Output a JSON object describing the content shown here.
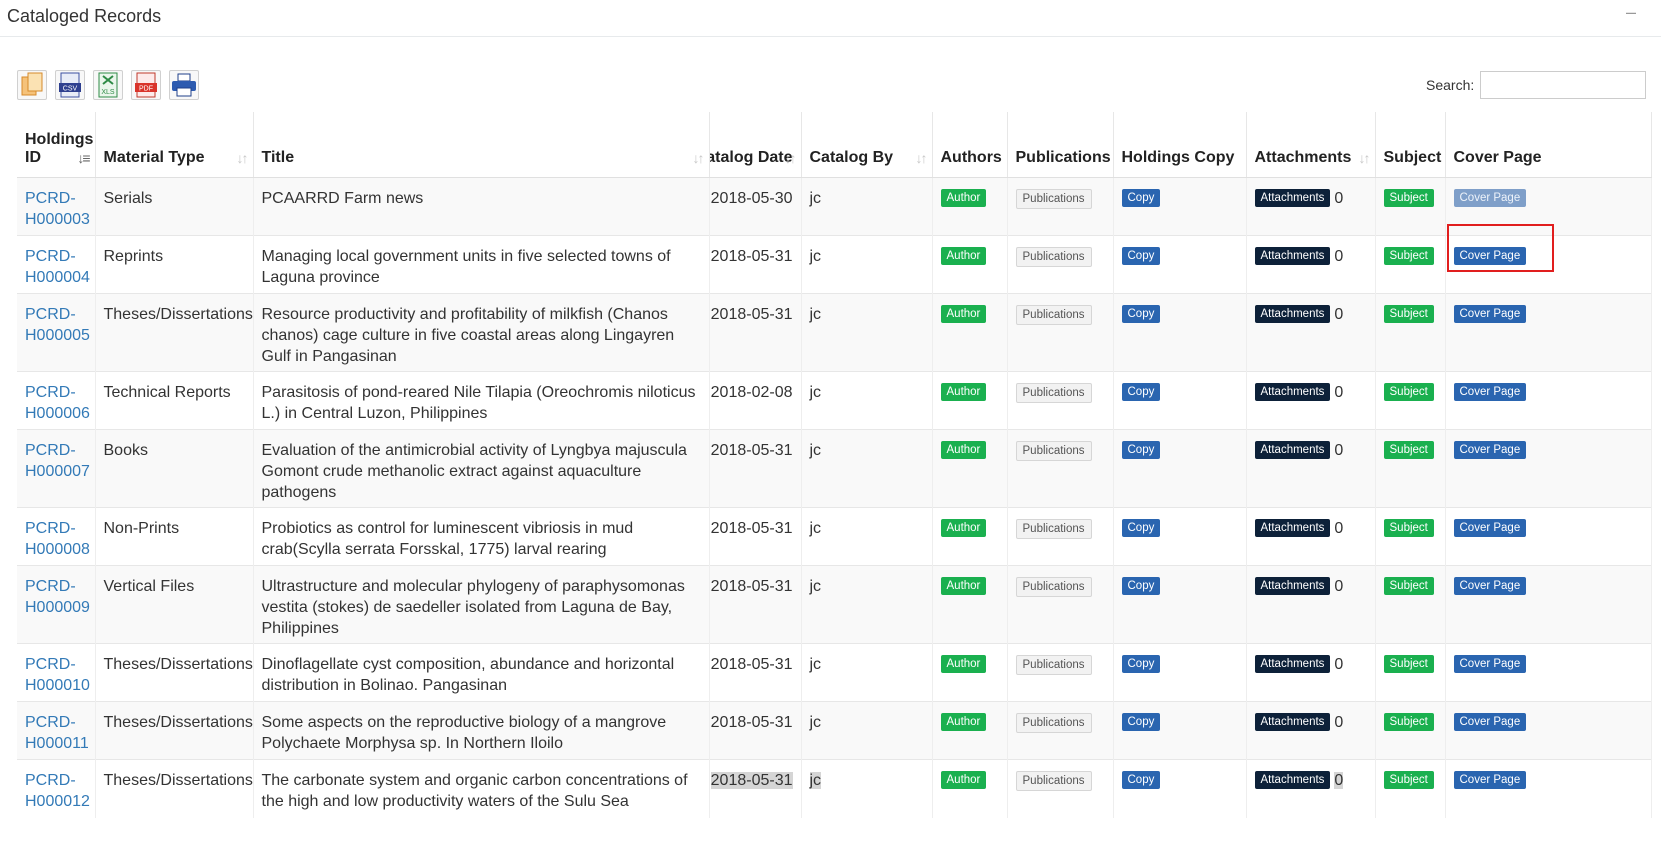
{
  "panel": {
    "title": "Cataloged Records",
    "collapse_icon": "minus-icon"
  },
  "toolbar": {
    "buttons": [
      {
        "name": "copy-button",
        "icon": "copy-icon"
      },
      {
        "name": "csv-button",
        "icon": "csv-icon",
        "label": "CSV"
      },
      {
        "name": "excel-button",
        "icon": "xls-icon",
        "label": "XLS"
      },
      {
        "name": "pdf-button",
        "icon": "pdf-icon",
        "label": "PDF"
      },
      {
        "name": "print-button",
        "icon": "printer-icon"
      }
    ]
  },
  "search": {
    "label": "Search:",
    "value": ""
  },
  "table": {
    "headers": {
      "holdings_id": "Holdings ID",
      "material_type": "Material Type",
      "title": "Title",
      "catalog_date": "Catalog Date",
      "catalog_by": "Catalog By",
      "authors": "Authors",
      "publications": "Publications",
      "holdings_copy": "Holdings Copy",
      "attachments": "Attachments",
      "subject": "Subject",
      "cover_page": "Cover Page"
    },
    "button_labels": {
      "author": "Author",
      "publications": "Publications",
      "copy": "Copy",
      "attachments": "Attachments",
      "subject": "Subject",
      "cover_page": "Cover Page"
    },
    "rows": [
      {
        "id": "PCRD-H000003",
        "type": "Serials",
        "title": "PCAARRD Farm news",
        "date": "2018-05-30",
        "by": "jc",
        "attachments": "0"
      },
      {
        "id": "PCRD-H000004",
        "type": "Reprints",
        "title": "Managing local government units in five selected towns of Laguna province",
        "date": "2018-05-31",
        "by": "jc",
        "attachments": "0"
      },
      {
        "id": "PCRD-H000005",
        "type": "Theses/Dissertations",
        "title": "Resource productivity and profitability of milkfish (Chanos chanos) cage culture in five coastal areas along Lingayren Gulf in Pangasinan",
        "date": "2018-05-31",
        "by": "jc",
        "attachments": "0"
      },
      {
        "id": "PCRD-H000006",
        "type": "Technical Reports",
        "title": "Parasitosis of pond-reared Nile Tilapia (Oreochromis niloticus L.) in Central Luzon, Philippines",
        "date": "2018-02-08",
        "by": "jc",
        "attachments": "0"
      },
      {
        "id": "PCRD-H000007",
        "type": "Books",
        "title": "Evaluation of the antimicrobial activity of Lyngbya majuscula Gomont crude methanolic extract against aquaculture pathogens",
        "date": "2018-05-31",
        "by": "jc",
        "attachments": "0"
      },
      {
        "id": "PCRD-H000008",
        "type": "Non-Prints",
        "title": "Probiotics as control for luminescent vibriosis in mud crab(Scylla serrata Forsskal, 1775) larval rearing",
        "date": "2018-05-31",
        "by": "jc",
        "attachments": "0"
      },
      {
        "id": "PCRD-H000009",
        "type": "Vertical Files",
        "title": "Ultrastructure and molecular phylogeny of paraphysomonas vestita (stokes) de saedeller isolated from Laguna de Bay, Philippines",
        "date": "2018-05-31",
        "by": "jc",
        "attachments": "0"
      },
      {
        "id": "PCRD-H000010",
        "type": "Theses/Dissertations",
        "title": "Dinoflagellate cyst composition, abundance and horizontal distribution in Bolinao. Pangasinan",
        "date": "2018-05-31",
        "by": "jc",
        "attachments": "0"
      },
      {
        "id": "PCRD-H000011",
        "type": "Theses/Dissertations",
        "title": "Some aspects on the reproductive biology of a mangrove Polychaete Morphysa sp. In Northern Iloilo",
        "date": "2018-05-31",
        "by": "jc",
        "attachments": "0"
      },
      {
        "id": "PCRD-H000012",
        "type": "Theses/Dissertations",
        "title": "The carbonate system and organic carbon concentrations of the high and low productivity waters of the Sulu Sea",
        "date": "2018-05-31",
        "by": "jc",
        "attachments": "0"
      }
    ]
  },
  "colors": {
    "author": "#1ab04f",
    "copy": "#2a65b0",
    "attachments": "#0d2139",
    "cover_page": "#2a65b0",
    "link": "#337ab7",
    "annotation": "#e11e1e"
  }
}
